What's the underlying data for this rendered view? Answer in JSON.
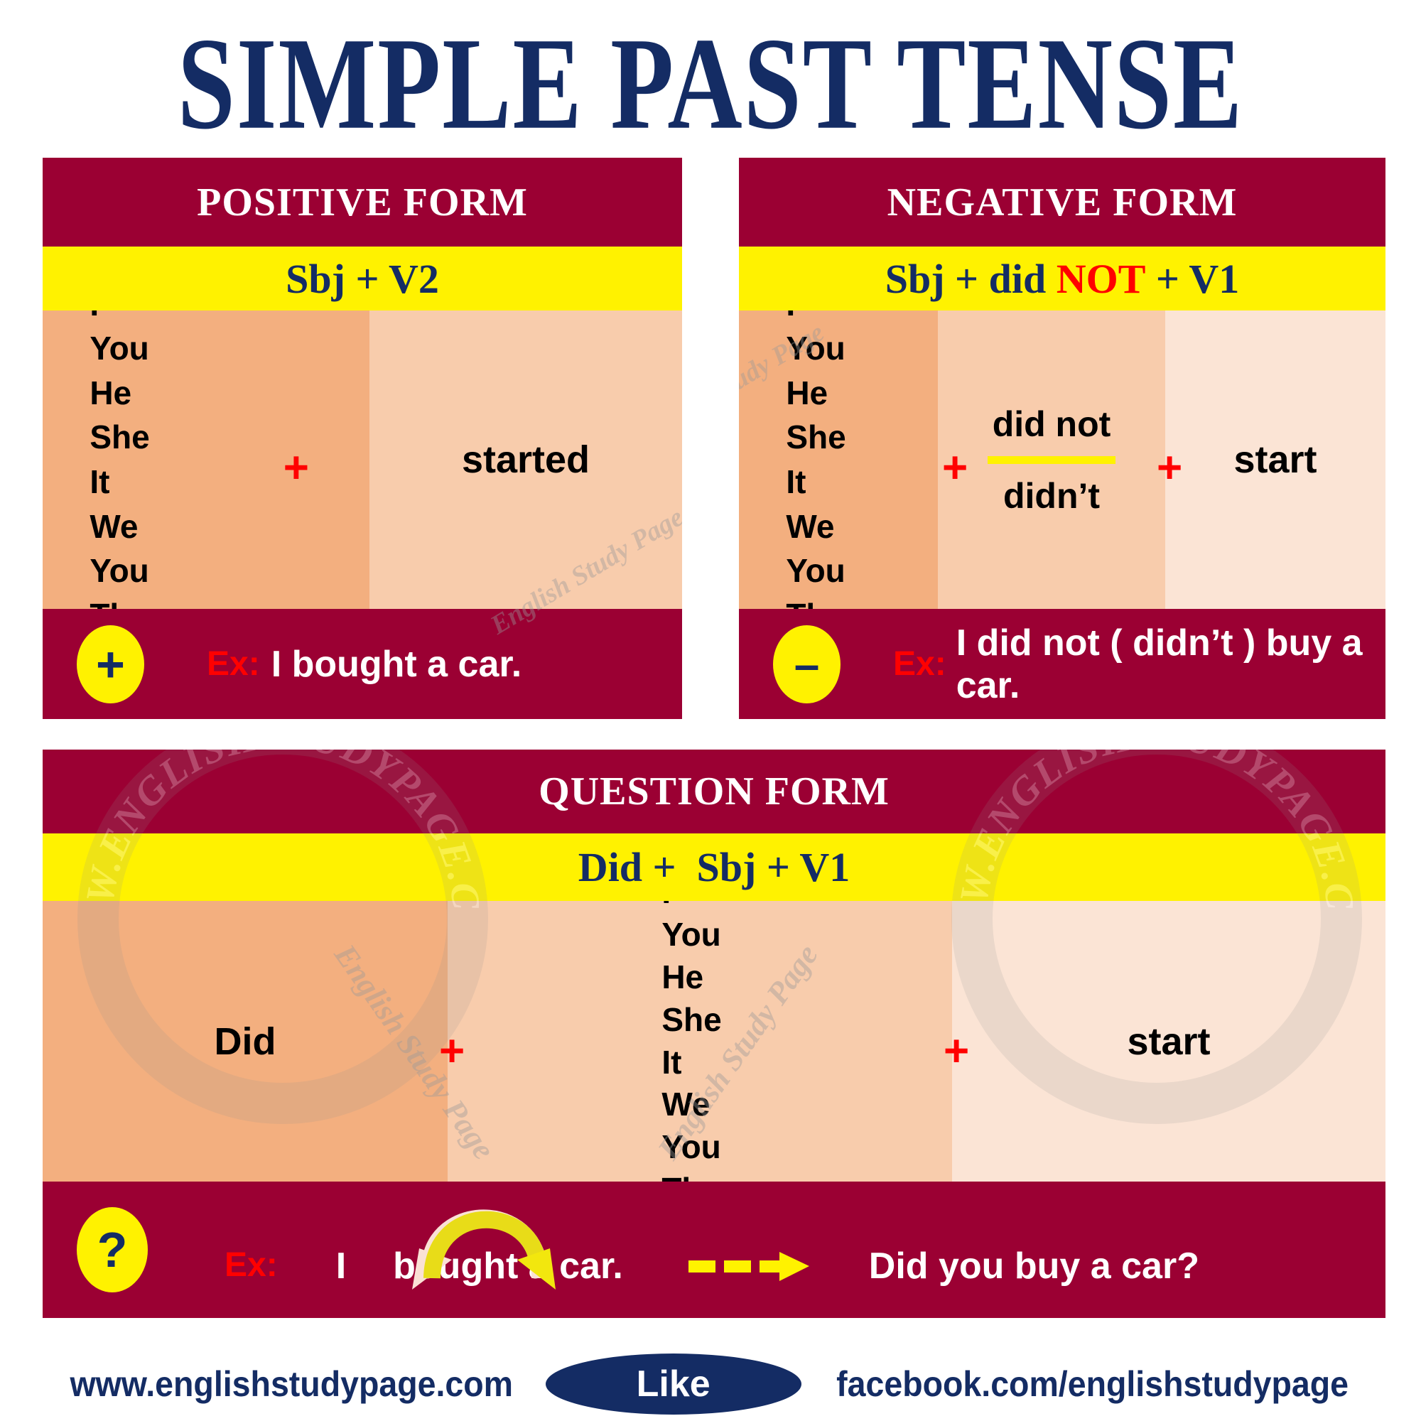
{
  "title": "SIMPLE PAST TENSE",
  "pronouns": [
    "I",
    "You",
    "He",
    "She",
    "It",
    "We",
    "You",
    "They"
  ],
  "symbols": {
    "plus": "+",
    "plus_badge": "+",
    "minus_badge": "–",
    "question_badge": "?",
    "ex_label": "Ex:"
  },
  "positive": {
    "heading": "POSITIVE FORM",
    "formula_prefix": "Sbj + V2",
    "verb": "started",
    "example": "I bought a car.",
    "badge": "+"
  },
  "negative": {
    "heading": "NEGATIVE FORM",
    "formula_a": "Sbj + did ",
    "formula_not": "NOT",
    "formula_b": " + V1",
    "aux_full": "did not",
    "aux_short": "didn’t",
    "verb": "start",
    "example": "I did not ( didn’t ) buy a car.",
    "badge": "–"
  },
  "question": {
    "heading": "QUESTION FORM",
    "formula": "Did +  Sbj + V1",
    "aux": "Did",
    "verb": "start",
    "badge": "?",
    "example_source": "I",
    "example_source_verb": "bought  a car.",
    "example_result": "Did you buy a car?"
  },
  "watermarks": {
    "diagonal": "English Study Page",
    "ring": "WWW.ENGLISHSTUDYPAGE.COM"
  },
  "footer": {
    "website": "www.englishstudypage.com",
    "like": "Like",
    "facebook": "facebook.com/englishstudypage"
  },
  "colors": {
    "maroon": "#9B0033",
    "yellow": "#FFF200",
    "navy": "#142C64",
    "red": "#FF0000",
    "salmon_dark": "#F3AF7F",
    "salmon_mid": "#F8CCAC",
    "salmon_light": "#FBE4D5",
    "white": "#FFFFFF"
  }
}
